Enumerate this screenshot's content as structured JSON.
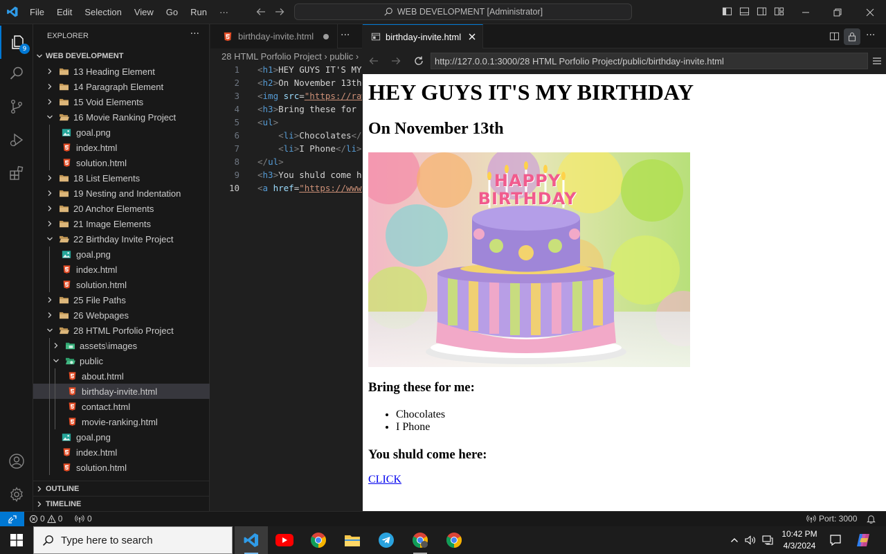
{
  "titlebar": {
    "menu": [
      "File",
      "Edit",
      "Selection",
      "View",
      "Go",
      "Run",
      "···"
    ],
    "search_text": "WEB DEVELOPMENT [Administrator]"
  },
  "activity": {
    "explorer_badge": "9"
  },
  "sidebar": {
    "title": "EXPLORER",
    "more": "···",
    "workspace": "WEB DEVELOPMENT",
    "tree": [
      {
        "label": "13 Heading Element",
        "type": "folder",
        "open": false,
        "depth": 0
      },
      {
        "label": "14 Paragraph Element",
        "type": "folder",
        "open": false,
        "depth": 0
      },
      {
        "label": "15 Void Elements",
        "type": "folder",
        "open": false,
        "depth": 0
      },
      {
        "label": "16 Movie Ranking Project",
        "type": "folder",
        "open": true,
        "depth": 0
      },
      {
        "label": "goal.png",
        "type": "image",
        "depth": 1
      },
      {
        "label": "index.html",
        "type": "html",
        "depth": 1
      },
      {
        "label": "solution.html",
        "type": "html",
        "depth": 1
      },
      {
        "label": "18 List Elements",
        "type": "folder",
        "open": false,
        "depth": 0
      },
      {
        "label": "19 Nesting and Indentation",
        "type": "folder",
        "open": false,
        "depth": 0
      },
      {
        "label": "20 Anchor Elements",
        "type": "folder",
        "open": false,
        "depth": 0
      },
      {
        "label": "21 Image Elements",
        "type": "folder",
        "open": false,
        "depth": 0
      },
      {
        "label": "22 Birthday Invite Project",
        "type": "folder",
        "open": true,
        "depth": 0
      },
      {
        "label": "goal.png",
        "type": "image",
        "depth": 1
      },
      {
        "label": "index.html",
        "type": "html",
        "depth": 1
      },
      {
        "label": "solution.html",
        "type": "html",
        "depth": 1
      },
      {
        "label": "25 File Paths",
        "type": "folder",
        "open": false,
        "depth": 0
      },
      {
        "label": "26 Webpages",
        "type": "folder",
        "open": false,
        "depth": 0
      },
      {
        "label": "28 HTML Porfolio Project",
        "type": "folder",
        "open": true,
        "depth": 0
      },
      {
        "label": "assets",
        "label2": "images",
        "type": "assets",
        "open": false,
        "depth": 1
      },
      {
        "label": "public",
        "type": "public",
        "open": true,
        "depth": 1
      },
      {
        "label": "about.html",
        "type": "html",
        "depth": 2
      },
      {
        "label": "birthday-invite.html",
        "type": "html",
        "depth": 2,
        "selected": true
      },
      {
        "label": "contact.html",
        "type": "html",
        "depth": 2
      },
      {
        "label": "movie-ranking.html",
        "type": "html",
        "depth": 2
      },
      {
        "label": "goal.png",
        "type": "image",
        "depth": 1
      },
      {
        "label": "index.html",
        "type": "html",
        "depth": 1
      },
      {
        "label": "solution.html",
        "type": "html",
        "depth": 1
      }
    ],
    "outline": "OUTLINE",
    "timeline": "TIMELINE"
  },
  "editor1": {
    "tab_label": "birthday-invite.html",
    "more": "···",
    "breadcrumb": "28 HTML Porfolio Project  ›  public  ›",
    "lines": [
      {
        "n": "1",
        "indent": "",
        "parts": [
          [
            "brk",
            "<"
          ],
          [
            "tag",
            "h1"
          ],
          [
            "brk",
            ">"
          ],
          [
            "txt",
            "HEY GUYS IT'S MY BIRTHDAY"
          ]
        ]
      },
      {
        "n": "2",
        "indent": "",
        "parts": [
          [
            "brk",
            "<"
          ],
          [
            "tag",
            "h2"
          ],
          [
            "brk",
            ">"
          ],
          [
            "txt",
            "On November 13th"
          ]
        ]
      },
      {
        "n": "3",
        "indent": "",
        "parts": [
          [
            "brk",
            "<"
          ],
          [
            "tag",
            "img"
          ],
          [
            "txt",
            " "
          ],
          [
            "attr",
            "src"
          ],
          [
            "txt",
            "="
          ],
          [
            "str",
            "\"https://raw.githubusercontent"
          ]
        ]
      },
      {
        "n": "4",
        "indent": "",
        "parts": [
          [
            "brk",
            "<"
          ],
          [
            "tag",
            "h3"
          ],
          [
            "brk",
            ">"
          ],
          [
            "txt",
            "Bring these for me:"
          ]
        ]
      },
      {
        "n": "5",
        "indent": "",
        "parts": [
          [
            "brk",
            "<"
          ],
          [
            "tag",
            "ul"
          ],
          [
            "brk",
            ">"
          ]
        ]
      },
      {
        "n": "6",
        "indent": "    ",
        "parts": [
          [
            "brk",
            "<"
          ],
          [
            "tag",
            "li"
          ],
          [
            "brk",
            ">"
          ],
          [
            "txt",
            "Chocolates"
          ],
          [
            "brk",
            "</"
          ],
          [
            "tag",
            "li"
          ],
          [
            "brk",
            ">"
          ]
        ]
      },
      {
        "n": "7",
        "indent": "    ",
        "parts": [
          [
            "brk",
            "<"
          ],
          [
            "tag",
            "li"
          ],
          [
            "brk",
            ">"
          ],
          [
            "txt",
            "I Phone"
          ],
          [
            "brk",
            "</"
          ],
          [
            "tag",
            "li"
          ],
          [
            "brk",
            ">"
          ]
        ]
      },
      {
        "n": "8",
        "indent": "",
        "parts": [
          [
            "brk",
            "</"
          ],
          [
            "tag",
            "ul"
          ],
          [
            "brk",
            ">"
          ]
        ]
      },
      {
        "n": "9",
        "indent": "",
        "parts": [
          [
            "brk",
            "<"
          ],
          [
            "tag",
            "h3"
          ],
          [
            "brk",
            ">"
          ],
          [
            "txt",
            "You shuld come here:"
          ]
        ]
      },
      {
        "n": "10",
        "indent": "",
        "current": true,
        "parts": [
          [
            "brk",
            "<"
          ],
          [
            "tag",
            "a"
          ],
          [
            "txt",
            " "
          ],
          [
            "attr",
            "href"
          ],
          [
            "txt",
            "="
          ],
          [
            "str",
            "\"https://www.google.com"
          ]
        ]
      }
    ]
  },
  "browser": {
    "tab_label": "birthday-invite.html",
    "url": "http://127.0.0.1:3000/28 HTML Porfolio Project/public/birthday-invite.html",
    "page": {
      "h1": "HEY GUYS IT'S MY BIRTHDAY",
      "h2": "On November 13th",
      "h3_bring": "Bring these for me:",
      "items": [
        "Chocolates",
        "I Phone"
      ],
      "h3_come": "You shuld come here:",
      "link": "CLICK",
      "cake_lettering": "HAPPY BIRTHDAY"
    }
  },
  "statusbar": {
    "errors": "0",
    "warnings": "0",
    "ports_count": "0",
    "port": "Port: 3000"
  },
  "taskbar": {
    "search_placeholder": "Type here to search",
    "time": "10:42 PM",
    "date": "4/3/2024"
  },
  "colors": {
    "accent": "#0078d4",
    "html_icon": "#e44d26",
    "folder": "#dcb67a",
    "link": "#0000ee"
  }
}
